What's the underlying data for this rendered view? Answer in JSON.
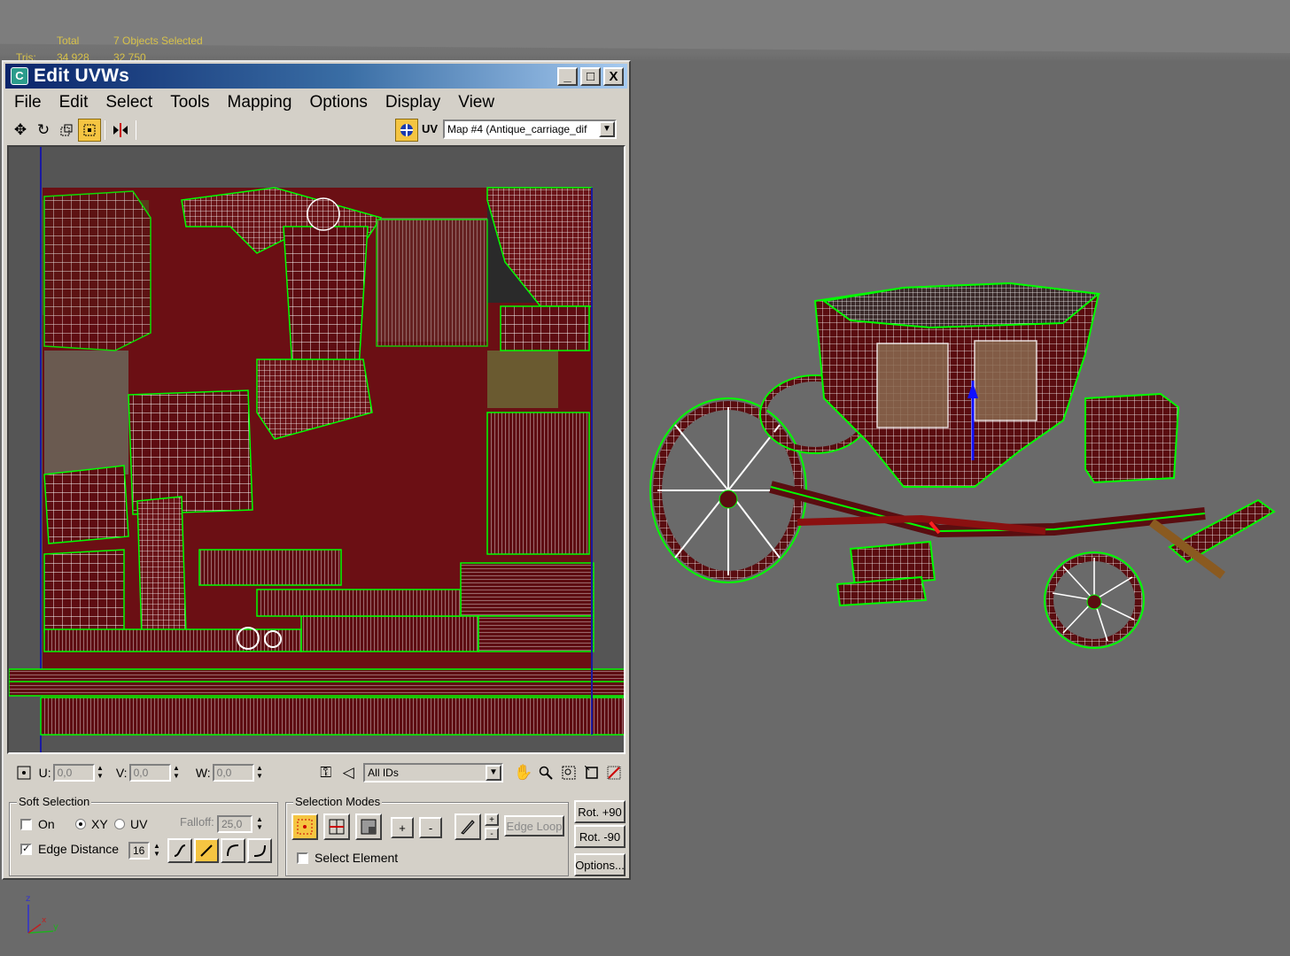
{
  "viewport": {
    "stats": {
      "total_label": "Total",
      "selection_label": "7 Objects Selected",
      "tris_label": "Tris:",
      "tris_total": "34 928",
      "tris_selected": "32 750"
    },
    "axis_labels": {
      "x": "x",
      "y": "y",
      "z": "z"
    }
  },
  "window": {
    "title": "Edit UVWs",
    "app_icon": "3ds-max-icon",
    "controls": {
      "minimize": "_",
      "maximize": "□",
      "close": "X"
    }
  },
  "menu": [
    "File",
    "Edit",
    "Select",
    "Tools",
    "Mapping",
    "Options",
    "Display",
    "View"
  ],
  "toolbar": {
    "tools": [
      "move-icon",
      "rotate-icon",
      "scale-icon",
      "freeform-icon",
      "mirror-icon"
    ],
    "uv_label": "UV",
    "map_select_value": "Map #4 (Antique_carriage_dif"
  },
  "bottom_bar": {
    "u_label": "U:",
    "u_value": "0,0",
    "v_label": "V:",
    "v_value": "0,0",
    "w_label": "W:",
    "w_value": "0,0",
    "ids_select_value": "All IDs"
  },
  "soft_selection": {
    "title": "Soft Selection",
    "on_label": "On",
    "on_checked": false,
    "xy_label": "XY",
    "uv_label": "UV",
    "falloff_label": "Falloff:",
    "falloff_value": "25,0",
    "edge_distance_label": "Edge Distance",
    "edge_distance_checked": true,
    "edge_distance_value": "16"
  },
  "selection_modes": {
    "title": "Selection Modes",
    "plus_label": "+",
    "minus_label": "-",
    "edge_loop_label": "Edge Loop",
    "select_element_label": "Select Element",
    "select_element_checked": false
  },
  "rotation": {
    "rot_plus_label": "Rot. +90",
    "rot_minus_label": "Rot. -90",
    "options_label": "Options..."
  },
  "colors": {
    "title_bar_start": "#0a246a",
    "title_bar_end": "#a6caf0",
    "texture_red": "#6b0f0f",
    "wire_white": "#ffffff",
    "wire_green": "#00ff00",
    "active_tool": "#f5c542"
  }
}
